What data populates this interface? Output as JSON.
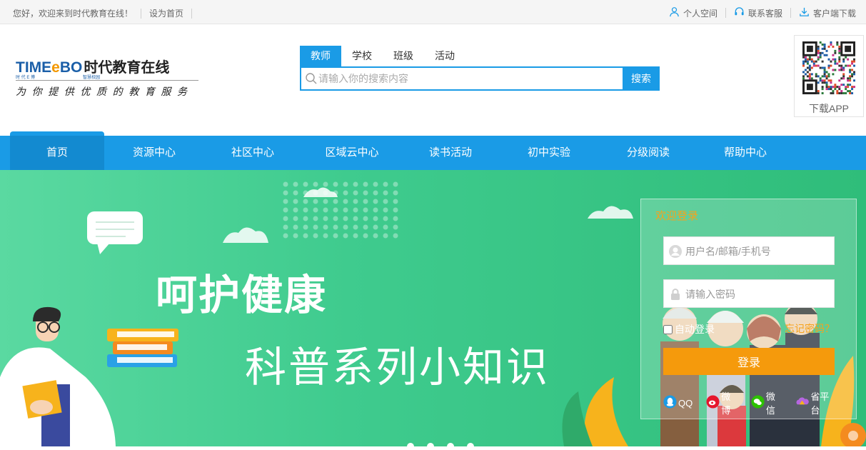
{
  "topbar": {
    "welcome": "您好，欢迎来到时代教育在线！",
    "set_home": "设为首页",
    "personal_space": "个人空间",
    "contact_service": "联系客服",
    "client_download": "客户端下载"
  },
  "logo": {
    "brand_prefix": "TIME",
    "brand_e": "e",
    "brand_suffix": "BO",
    "brand_cn": "时代教育在线",
    "sub_left": "时 代 E 博",
    "sub_right": "智慧校园",
    "slogan": "为你提供优质的教育服务"
  },
  "search": {
    "tabs": [
      {
        "label": "教师",
        "active": true
      },
      {
        "label": "学校",
        "active": false
      },
      {
        "label": "班级",
        "active": false
      },
      {
        "label": "活动",
        "active": false
      }
    ],
    "placeholder": "请输入你的搜索内容",
    "button": "搜索"
  },
  "app": {
    "label": "下载APP"
  },
  "nav": {
    "items": [
      {
        "label": "首页",
        "active": true
      },
      {
        "label": "资源中心",
        "active": false
      },
      {
        "label": "社区中心",
        "active": false
      },
      {
        "label": "区域云中心",
        "active": false
      },
      {
        "label": "读书活动",
        "active": false
      },
      {
        "label": "初中实验",
        "active": false
      },
      {
        "label": "分级阅读",
        "active": false
      },
      {
        "label": "帮助中心",
        "active": false
      }
    ]
  },
  "banner": {
    "title1": "呵护健康",
    "title2": "科普系列小知识",
    "bg_color": "#3fcb8e"
  },
  "login": {
    "title": "欢迎登录",
    "username_placeholder": "用户名/邮箱/手机号",
    "password_placeholder": "请输入密码",
    "remember": "自动登录",
    "forgot": "忘记密码？",
    "submit": "登录",
    "socials": [
      {
        "icon": "qq-icon",
        "label": "QQ",
        "color": "#1a9be6"
      },
      {
        "icon": "weibo-icon",
        "label": "微博",
        "color": "#e6162d"
      },
      {
        "icon": "wechat-icon",
        "label": "微信",
        "color": "#2dc100"
      },
      {
        "icon": "province-platform-icon",
        "label": "省平台",
        "color": "#b566e0"
      }
    ]
  },
  "colors": {
    "primary": "#1a9be6",
    "accent": "#f59a0c",
    "brand_blue": "#1b5fa8"
  }
}
